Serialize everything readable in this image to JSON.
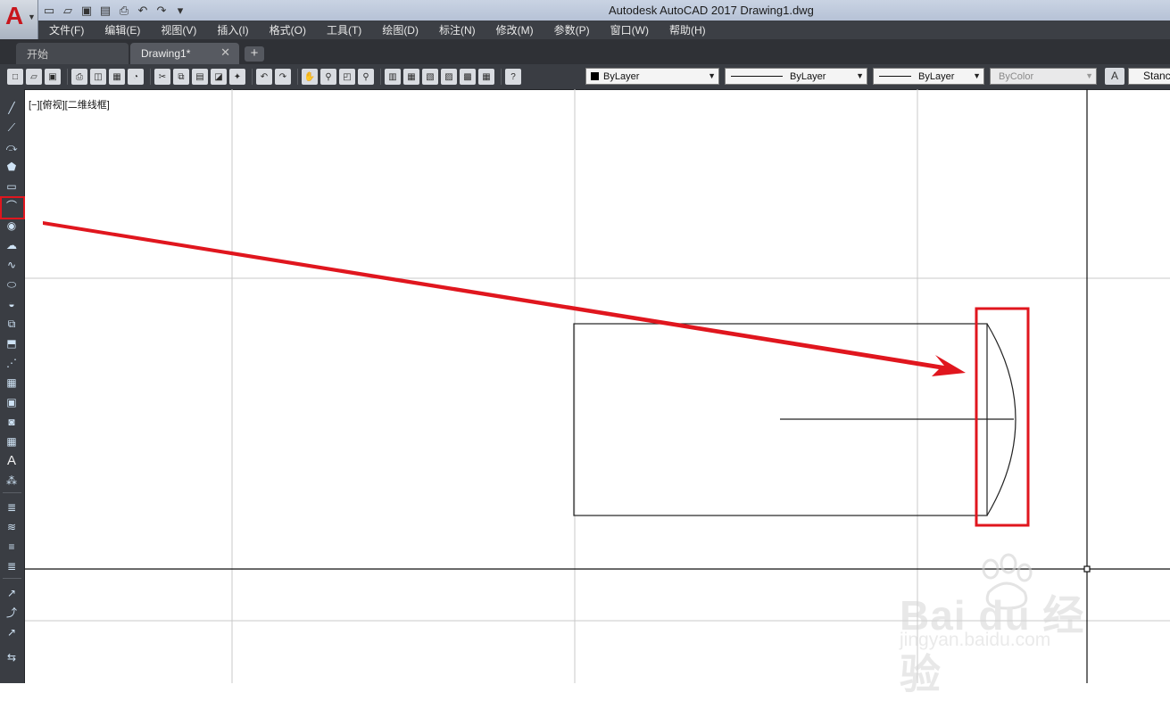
{
  "app": {
    "title": "Autodesk AutoCAD 2017    Drawing1.dwg",
    "logo_letter": "A"
  },
  "quick_access": [
    "new-icon",
    "open-icon",
    "save-icon",
    "saveas-icon",
    "plot-icon",
    "undo-icon",
    "redo-icon",
    "customize-icon"
  ],
  "menu": [
    "文件(F)",
    "编辑(E)",
    "视图(V)",
    "插入(I)",
    "格式(O)",
    "工具(T)",
    "绘图(D)",
    "标注(N)",
    "修改(M)",
    "参数(P)",
    "窗口(W)",
    "帮助(H)"
  ],
  "tabs": {
    "start": "开始",
    "drawing": "Drawing1*",
    "close": "✕",
    "add": "+"
  },
  "properties": {
    "color": "ByLayer",
    "linetype": "ByLayer",
    "lineweight": "ByLayer",
    "plotstyle": "ByColor",
    "text_style": "Stanc"
  },
  "viewport_label": "[−][俯视][二维线框]",
  "watermark": {
    "brand": "Bai du 经验",
    "url": "jingyan.baidu.com"
  },
  "colors": {
    "highlight": "#e0161e",
    "menubar": "#3c3f45",
    "toolbar": "#3a3d43"
  }
}
